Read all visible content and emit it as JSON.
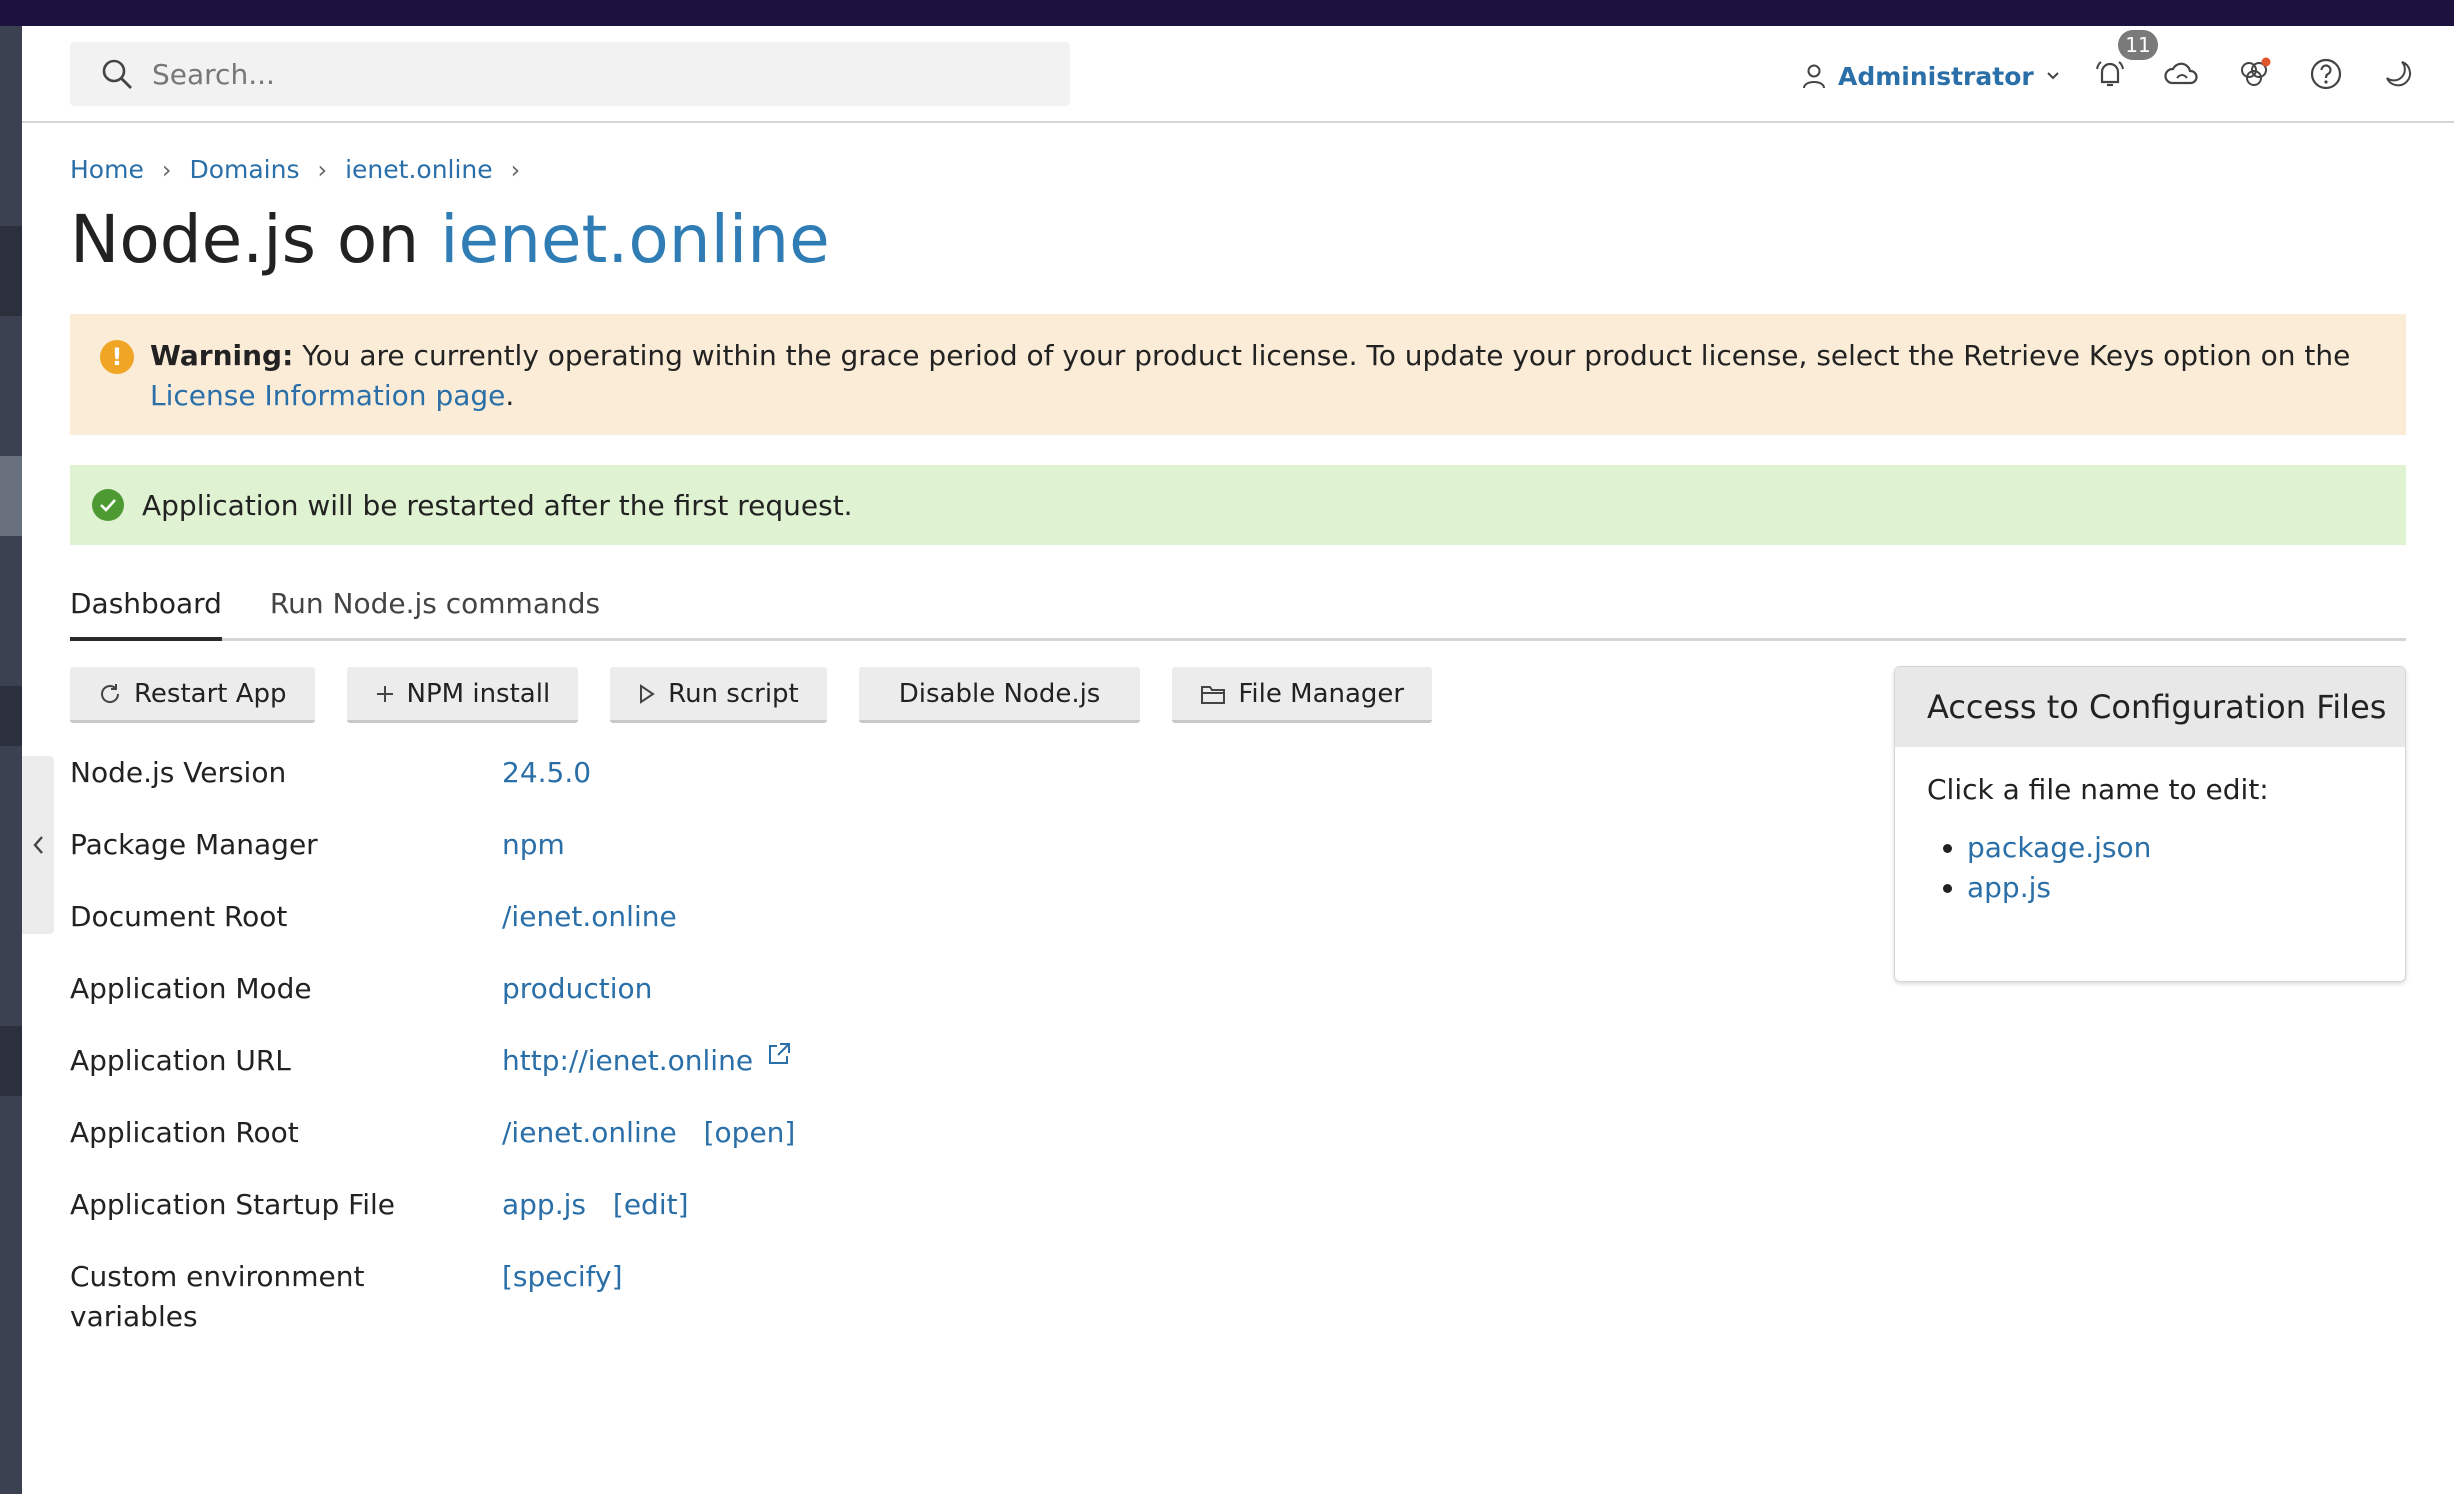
{
  "header": {
    "search_placeholder": "Search...",
    "user_label": "Administrator",
    "notification_count": "11"
  },
  "breadcrumb": [
    "Home",
    "Domains",
    "ienet.online"
  ],
  "page": {
    "title_prefix": "Node.js on",
    "title_domain": "ienet.online"
  },
  "warning": {
    "bold": "Warning:",
    "text": "You are currently operating within the grace period of your product license. To update your product license, select the Retrieve Keys option on the",
    "link": "License Information page",
    "tail": "."
  },
  "success": {
    "text": "Application will be restarted after the first request."
  },
  "tabs": [
    "Dashboard",
    "Run Node.js commands"
  ],
  "toolbar": {
    "restart": "Restart App",
    "npm": "NPM install",
    "run": "Run script",
    "disable": "Disable Node.js",
    "files": "File Manager"
  },
  "details": {
    "nodejs_version": {
      "label": "Node.js Version",
      "value": "24.5.0"
    },
    "package_manager": {
      "label": "Package Manager",
      "value": "npm"
    },
    "document_root": {
      "label": "Document Root",
      "value": "/ienet.online"
    },
    "app_mode": {
      "label": "Application Mode",
      "value": "production"
    },
    "app_url": {
      "label": "Application URL",
      "value": "http://ienet.online"
    },
    "app_root": {
      "label": "Application Root",
      "value": "/ienet.online",
      "action": "[open]"
    },
    "startup_file": {
      "label": "Application Startup File",
      "value": "app.js",
      "action": "[edit]"
    },
    "env_vars": {
      "label_line1": "Custom environment",
      "label_line2": "variables",
      "action": "[specify]"
    }
  },
  "config": {
    "title": "Access to Configuration Files",
    "hint": "Click a file name to edit:",
    "files": [
      "package.json",
      "app.js"
    ]
  },
  "colors": {
    "link": "#2a6fa8",
    "warning_bg": "#fbecd8",
    "success_bg": "#dff2d2",
    "topbar": "#1c1240"
  }
}
